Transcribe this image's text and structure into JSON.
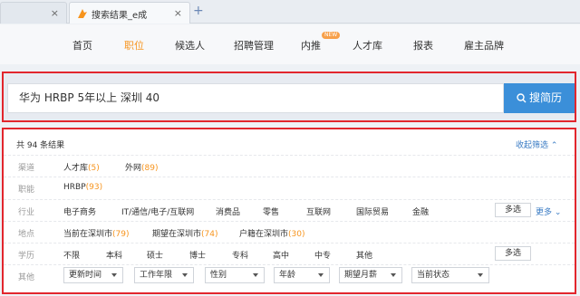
{
  "browser": {
    "active_tab_title": "搜索结果_e成",
    "new_tab_label": "+",
    "close_symbol": "×"
  },
  "nav": {
    "items": [
      "首页",
      "职位",
      "候选人",
      "招聘管理",
      "内推",
      "人才库",
      "报表",
      "雇主品牌"
    ],
    "active_index": 1,
    "badge": "NEW"
  },
  "search": {
    "query": "华为 HRBP 5年以上 深圳 40",
    "button_label": "搜简历"
  },
  "filters": {
    "total": "共 94 条结果",
    "collapse_label": "收起筛选",
    "channel": {
      "label": "渠道",
      "options": [
        {
          "name": "人才库",
          "count": "(5)"
        },
        {
          "name": "外网",
          "count": "(89)"
        }
      ]
    },
    "position": {
      "label": "职能",
      "options": [
        {
          "name": "HRBP",
          "count": "(93)"
        }
      ]
    },
    "industry": {
      "label": "行业",
      "options": [
        "电子商务",
        "IT/通信/电子/互联网",
        "消费品",
        "零售",
        "互联网",
        "国际贸易",
        "金融"
      ],
      "multi_label": "多选",
      "more_label": "更多"
    },
    "location": {
      "label": "地点",
      "options": [
        {
          "name": "当前在深圳市",
          "count": "(79)"
        },
        {
          "name": "期望在深圳市",
          "count": "(74)"
        },
        {
          "name": "户籍在深圳市",
          "count": "(30)"
        }
      ]
    },
    "education": {
      "label": "学历",
      "options": [
        "不限",
        "本科",
        "硕士",
        "博士",
        "专科",
        "高中",
        "中专",
        "其他"
      ],
      "multi_label": "多选"
    },
    "other": {
      "label": "其他",
      "selects": [
        "更新时间",
        "工作年限",
        "性别",
        "年龄",
        "期望月薪",
        "当前状态"
      ]
    }
  },
  "colors": {
    "accent": "#f7941d",
    "primary": "#3b8fd9",
    "highlight_border": "#e2262d"
  }
}
